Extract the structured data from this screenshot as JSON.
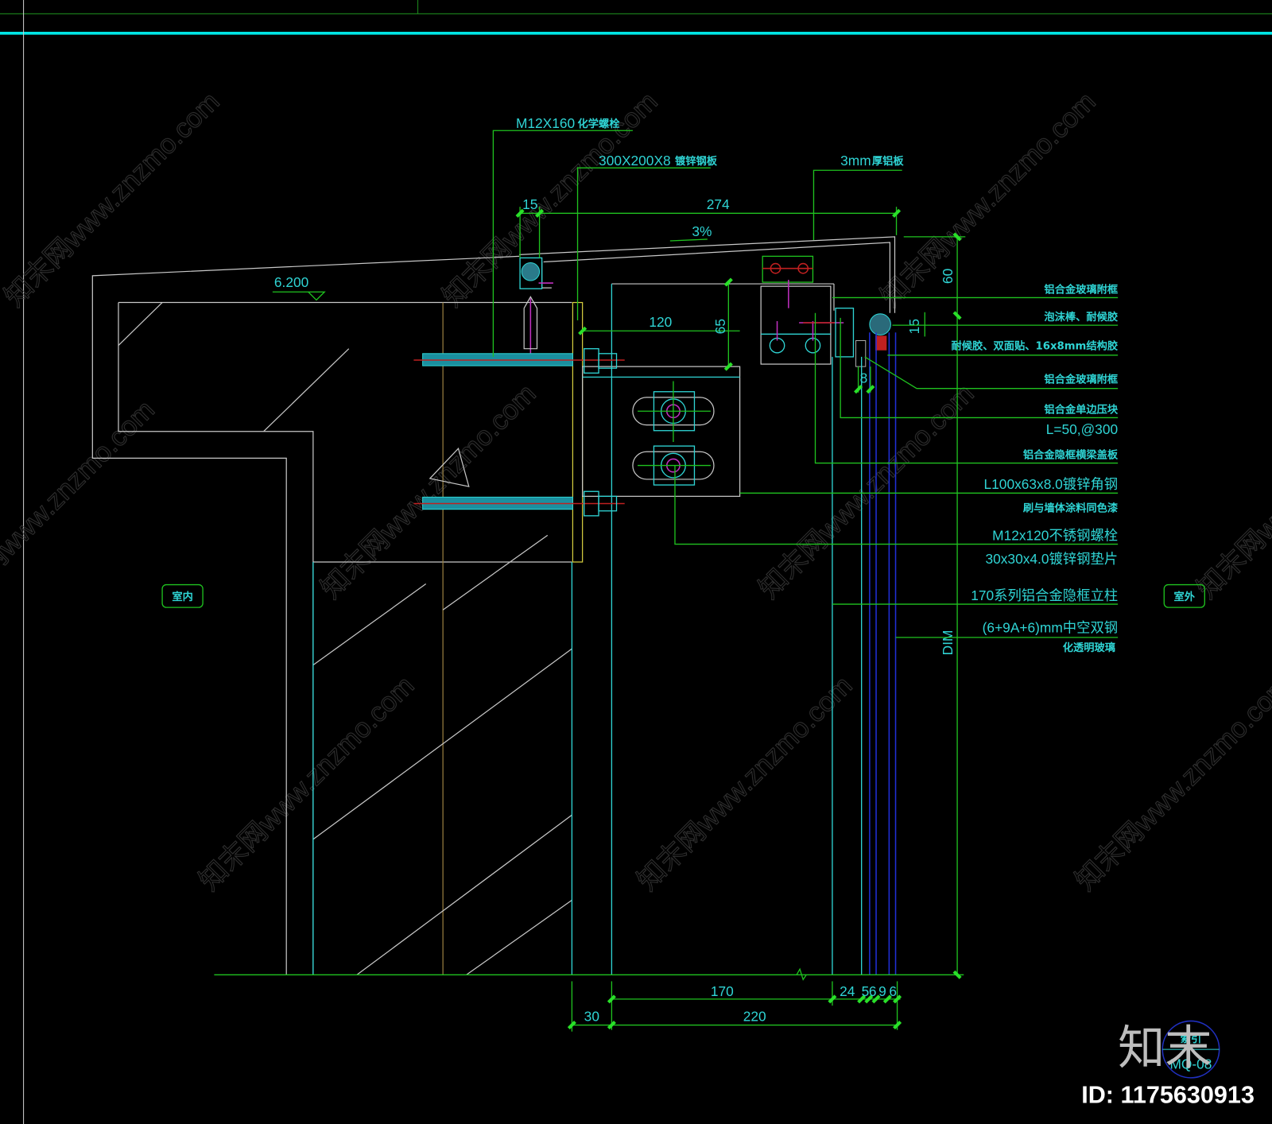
{
  "drawing": {
    "type": "curtain wall top node section (CAD)",
    "elevation_mark": "6.200",
    "slope": "3%",
    "zones": {
      "inside": "室内",
      "outside": "室外"
    },
    "callouts_top": [
      {
        "id": "chem-bolt",
        "text": "M12X160",
        "suffix": "化学螺栓"
      },
      {
        "id": "steel-plate",
        "text": "300X200X8",
        "suffix": "镀锌钢板"
      },
      {
        "id": "alu-panel",
        "text": "3mm",
        "suffix": "厚铝板"
      }
    ],
    "callouts_right": [
      {
        "id": "glass-subframe-1",
        "lines": [
          "铝合金玻璃附框"
        ]
      },
      {
        "id": "foam-rod",
        "lines": [
          "泡沫棒、耐候胶"
        ]
      },
      {
        "id": "sealant",
        "lines": [
          "耐候胶、双面贴、16x8mm结构胶"
        ]
      },
      {
        "id": "glass-subframe-2",
        "lines": [
          "铝合金玻璃附框"
        ]
      },
      {
        "id": "pressure-block",
        "lines": [
          "铝合金单边压块",
          "L=50,@300"
        ]
      },
      {
        "id": "transom-cover",
        "lines": [
          "铝合金隐框横梁盖板"
        ]
      },
      {
        "id": "angle-steel",
        "lines": [
          "L100x63x8.0镀锌角钢",
          "刷与墙体涂料同色漆"
        ]
      },
      {
        "id": "ss-bolt",
        "lines": [
          "M12x120不锈钢螺栓",
          "30x30x4.0镀锌钢垫片"
        ]
      },
      {
        "id": "mullion",
        "lines": [
          "170系列铝合金隐框立柱"
        ]
      },
      {
        "id": "glass",
        "lines": [
          "(6+9A+6)mm中空双钢",
          "化透明玻璃"
        ]
      }
    ],
    "dimensions": {
      "top": [
        "15",
        "274"
      ],
      "left_vertical": "65",
      "horizontal_mid": "120",
      "right_vertical": [
        "60",
        "15",
        "DIM"
      ],
      "small": "8",
      "bottom_row1": [
        "170",
        "24",
        "5",
        "6",
        "9",
        "6"
      ],
      "bottom_row2": [
        "30",
        "220"
      ]
    },
    "detail_tag": {
      "title": "索引",
      "code": "MQ-08"
    }
  },
  "watermark": {
    "site": "知末网www.znzmo.com",
    "logo": "知末",
    "id_label": "ID: 1175630913"
  },
  "colors": {
    "background": "#000000",
    "text": "#2fd4d4",
    "dim_line": "#1fc21f",
    "outline": "#c8c8c8",
    "frame_top": "#00e5e5"
  }
}
